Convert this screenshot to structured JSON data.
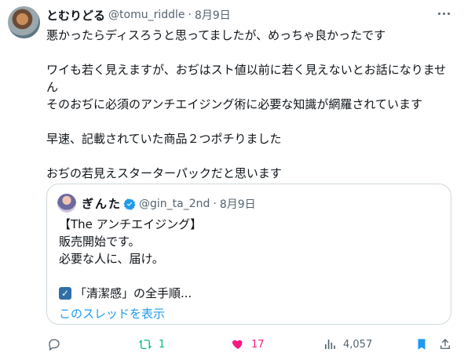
{
  "tweet": {
    "author": "とむりどる",
    "handle": "@tomu_riddle",
    "dot": "·",
    "date": "8月9日",
    "lines": [
      "悪かったらディスろうと思ってましたが、めっちゃ良かったです",
      "",
      "ワイも若く見えますが、おぢはスト値以前に若く見えないとお話になりませ",
      "ん",
      "そのおぢに必須のアンチエイジング術に必要な知識が網羅されています",
      "",
      "早速、記載されていた商品２つポチりました",
      "",
      "おぢの若見えスターターパックだと思います"
    ]
  },
  "quote": {
    "name": "ぎんた",
    "handle": "@gin_ta_2nd",
    "dot": "·",
    "date": "8月9日",
    "lines": [
      "【The アンチエイジング】",
      "販売開始です。",
      "必要な人に、届け。"
    ],
    "checked_line": "「清潔感」の全手順...",
    "thread_link": "このスレッドを表示"
  },
  "actions": {
    "retweets": "1",
    "likes": "17",
    "views": "4,057"
  },
  "colors": {
    "like": "#f91880",
    "retweet": "#00ba7c",
    "bookmark": "#1d9bf0",
    "link": "#1d9bf0"
  }
}
